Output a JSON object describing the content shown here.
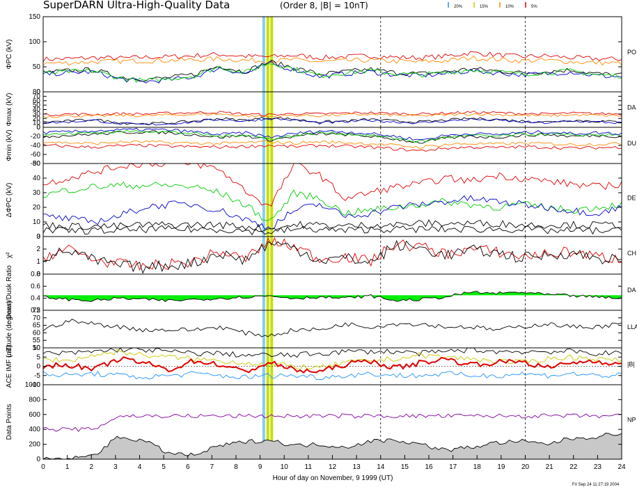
{
  "header": {
    "title": "SuperDARN Ultra-High-Quality Data",
    "subtitle": "(Order 8, |B| = 10nT)",
    "legend": [
      {
        "label": "20%",
        "color": "#1e90ff"
      },
      {
        "label": "15%",
        "color": "#c8c800"
      },
      {
        "label": "10%",
        "color": "#ff8c00"
      },
      {
        "label": "5%",
        "color": "#e00000"
      }
    ]
  },
  "footer": {
    "xlabel": "Hour of day on November, 9 1999 (UT)",
    "timestamp": "Fri Sep 24 11:27:19 2004"
  },
  "highlights": [
    {
      "hour": 9.15,
      "color": "#87ceeb"
    },
    {
      "hour": 9.32,
      "color": "#c8e000"
    },
    {
      "hour": 9.48,
      "color": "#c8e000"
    }
  ],
  "dashed_hours": [
    14,
    20
  ],
  "colors": {
    "red": "#e00000",
    "orange": "#ff8c00",
    "yellow": "#c8c800",
    "green": "#00cc00",
    "blue": "#0000c8",
    "black": "#000000",
    "cyan": "#1e90ff",
    "purple": "#8000a0",
    "gray": "#c8c8c8"
  },
  "chart_data": [
    {
      "id": "phi-pc",
      "type": "line",
      "ylabel": "ΦPC (kV)",
      "side_label": "PO",
      "ylim": [
        0,
        150
      ],
      "yticks": [
        0,
        50,
        100,
        150
      ],
      "xlim": [
        0,
        24
      ],
      "series": [
        {
          "color": "#e00000",
          "base": 68,
          "amp": 6,
          "values": [
            65,
            66,
            68,
            67,
            69,
            70,
            72,
            75,
            71,
            70,
            73,
            68,
            70,
            72,
            69,
            68,
            71,
            78,
            74,
            70,
            72,
            68,
            66,
            65
          ]
        },
        {
          "color": "#ff8c00",
          "base": 60,
          "amp": 5,
          "values": [
            57,
            58,
            60,
            61,
            62,
            63,
            64,
            66,
            63,
            62,
            64,
            60,
            62,
            63,
            61,
            60,
            62,
            68,
            65,
            62,
            63,
            60,
            58,
            57
          ]
        },
        {
          "color": "#000000",
          "base": 40,
          "amp": 9,
          "values": [
            38,
            42,
            44,
            30,
            25,
            28,
            35,
            52,
            40,
            60,
            48,
            35,
            40,
            45,
            38,
            36,
            40,
            46,
            42,
            38,
            40,
            44,
            36,
            34
          ]
        },
        {
          "color": "#0000c8",
          "base": 36,
          "amp": 8,
          "values": [
            35,
            38,
            40,
            26,
            20,
            24,
            30,
            48,
            36,
            56,
            44,
            30,
            36,
            40,
            34,
            32,
            36,
            42,
            38,
            34,
            36,
            40,
            32,
            30
          ]
        },
        {
          "color": "#00cc00",
          "base": 38,
          "amp": 8,
          "values": [
            36,
            40,
            42,
            28,
            22,
            26,
            32,
            50,
            38,
            58,
            46,
            32,
            38,
            42,
            36,
            34,
            38,
            44,
            40,
            36,
            38,
            42,
            34,
            32
          ]
        }
      ]
    },
    {
      "id": "phi-max",
      "type": "line",
      "ylabel": "Φmax (kV)",
      "side_label": "DA",
      "ylim": [
        0,
        80
      ],
      "yticks": [
        0,
        10,
        20,
        30,
        40,
        50,
        60,
        70,
        80
      ],
      "xlim": [
        0,
        24
      ],
      "series": [
        {
          "color": "#e00000",
          "values": [
            28,
            30,
            29,
            31,
            30,
            32,
            33,
            34,
            30,
            28,
            31,
            30,
            32,
            33,
            31,
            30,
            32,
            34,
            33,
            31,
            30,
            32,
            31,
            30
          ]
        },
        {
          "color": "#ff8c00",
          "values": [
            24,
            26,
            25,
            27,
            26,
            28,
            29,
            30,
            26,
            24,
            27,
            26,
            28,
            29,
            27,
            26,
            28,
            30,
            29,
            27,
            26,
            28,
            27,
            26
          ]
        },
        {
          "color": "#000000",
          "values": [
            12,
            14,
            18,
            10,
            8,
            10,
            14,
            20,
            16,
            22,
            18,
            12,
            14,
            18,
            14,
            12,
            16,
            20,
            18,
            14,
            12,
            16,
            14,
            12
          ]
        },
        {
          "color": "#0000c8",
          "values": [
            10,
            12,
            16,
            8,
            6,
            8,
            12,
            18,
            14,
            20,
            16,
            10,
            12,
            16,
            12,
            10,
            14,
            18,
            16,
            12,
            10,
            14,
            12,
            10
          ]
        }
      ]
    },
    {
      "id": "phi-min",
      "type": "line",
      "ylabel": "Φmin (kV)",
      "side_label": "DU",
      "ylim": [
        -80,
        0
      ],
      "yticks": [
        -80,
        -60,
        -40,
        -20,
        0
      ],
      "xlim": [
        0,
        24
      ],
      "series": [
        {
          "color": "#e00000",
          "values": [
            -40,
            -42,
            -44,
            -41,
            -40,
            -42,
            -43,
            -44,
            -42,
            -40,
            -43,
            -40,
            -42,
            -44,
            -48,
            -52,
            -46,
            -44,
            -45,
            -43,
            -44,
            -46,
            -45,
            -44
          ]
        },
        {
          "color": "#ff8c00",
          "values": [
            -32,
            -34,
            -36,
            -33,
            -32,
            -34,
            -35,
            -36,
            -34,
            -32,
            -35,
            -32,
            -34,
            -36,
            -40,
            -44,
            -38,
            -36,
            -37,
            -35,
            -36,
            -38,
            -37,
            -36
          ]
        },
        {
          "color": "#000000",
          "values": [
            -20,
            -18,
            -15,
            -12,
            -10,
            -12,
            -16,
            -22,
            -18,
            -28,
            -20,
            -14,
            -16,
            -20,
            -26,
            -34,
            -24,
            -20,
            -22,
            -18,
            -16,
            -20,
            -18,
            -20
          ]
        },
        {
          "color": "#00cc00",
          "values": [
            -16,
            -14,
            -12,
            -10,
            -8,
            -10,
            -14,
            -20,
            -16,
            -26,
            -18,
            -12,
            -14,
            -18,
            -24,
            -32,
            -22,
            -18,
            -20,
            -16,
            -14,
            -18,
            -16,
            -18
          ]
        },
        {
          "color": "#0000c8",
          "values": [
            -12,
            -10,
            -8,
            -6,
            -5,
            -6,
            -10,
            -16,
            -12,
            -22,
            -14,
            -8,
            -10,
            -14,
            -20,
            -28,
            -18,
            -14,
            -16,
            -12,
            -10,
            -14,
            -12,
            -14
          ]
        }
      ]
    },
    {
      "id": "delta-phi-pc",
      "type": "line",
      "ylabel": "ΔΦPC (kV)",
      "side_label": "DE",
      "ylim": [
        0,
        50
      ],
      "yticks": [
        0,
        10,
        20,
        30,
        40,
        50
      ],
      "xlim": [
        0,
        24
      ],
      "series": [
        {
          "color": "#e00000",
          "values": [
            36,
            40,
            44,
            48,
            50,
            50,
            50,
            46,
            32,
            20,
            50,
            42,
            26,
            30,
            34,
            36,
            40,
            38,
            42,
            40,
            38,
            36,
            34,
            36
          ]
        },
        {
          "color": "#00cc00",
          "values": [
            28,
            32,
            34,
            35,
            35,
            35,
            34,
            30,
            22,
            10,
            30,
            26,
            16,
            18,
            20,
            22,
            24,
            22,
            20,
            22,
            20,
            18,
            20,
            22
          ]
        },
        {
          "color": "#0000c8",
          "values": [
            14,
            12,
            10,
            14,
            20,
            22,
            22,
            18,
            12,
            6,
            18,
            22,
            14,
            16,
            20,
            22,
            24,
            26,
            24,
            22,
            20,
            18,
            16,
            20
          ]
        },
        {
          "color": "#000000",
          "values": [
            8,
            7,
            7,
            7,
            8,
            8,
            8,
            8,
            7,
            5,
            8,
            8,
            7,
            8,
            8,
            9,
            9,
            9,
            9,
            8,
            8,
            8,
            8,
            8
          ]
        },
        {
          "color": "#000000",
          "values": [
            4,
            4,
            4,
            4,
            5,
            5,
            5,
            5,
            4,
            3,
            5,
            5,
            4,
            5,
            5,
            5,
            5,
            5,
            5,
            5,
            4,
            4,
            4,
            4
          ]
        }
      ]
    },
    {
      "id": "chi-sq",
      "type": "line",
      "ylabel": "χ²",
      "side_label": "CH",
      "ylim": [
        0,
        3
      ],
      "yticks": [
        0,
        1,
        2,
        3
      ],
      "xlim": [
        0,
        24
      ],
      "series": [
        {
          "color": "#e00000",
          "values": [
            1.4,
            2.0,
            1.2,
            0.8,
            0.6,
            0.8,
            1.0,
            1.8,
            1.2,
            2.6,
            2.2,
            1.2,
            1.4,
            1.0,
            2.4,
            2.2,
            1.6,
            2.0,
            1.8,
            1.4,
            1.6,
            1.8,
            1.4,
            1.2
          ]
        },
        {
          "color": "#000000",
          "values": [
            1.3,
            1.9,
            1.1,
            0.7,
            0.5,
            0.7,
            0.9,
            1.7,
            1.1,
            2.5,
            2.1,
            1.1,
            1.3,
            0.9,
            2.3,
            2.1,
            1.5,
            1.9,
            1.7,
            1.3,
            1.5,
            1.7,
            1.3,
            1.1
          ]
        }
      ]
    },
    {
      "id": "dawn-dusk",
      "type": "area",
      "ylabel": "Dawn/Dusk Ratio",
      "side_label": "DA",
      "ylim": [
        0.2,
        0.8
      ],
      "yticks": [
        0.2,
        0.4,
        0.6,
        0.8
      ],
      "xlim": [
        0,
        24
      ],
      "series": [
        {
          "color": "#000000",
          "values": [
            0.42,
            0.38,
            0.36,
            0.4,
            0.38,
            0.36,
            0.38,
            0.4,
            0.42,
            0.44,
            0.4,
            0.42,
            0.4,
            0.44,
            0.36,
            0.38,
            0.42,
            0.5,
            0.48,
            0.5,
            0.46,
            0.44,
            0.42,
            0.4
          ]
        }
      ]
    },
    {
      "id": "latitude",
      "type": "line",
      "ylabel": "Latitude (degrees)",
      "side_label": "LLA",
      "ylim": [
        50,
        75
      ],
      "yticks": [
        50,
        55,
        60,
        65,
        70,
        75
      ],
      "xlim": [
        0,
        24
      ],
      "series": [
        {
          "color": "#000000",
          "values": [
            62,
            68,
            66,
            64,
            62,
            62,
            62,
            64,
            60,
            58,
            62,
            62,
            66,
            64,
            66,
            66,
            64,
            64,
            62,
            64,
            66,
            64,
            64,
            66
          ]
        }
      ]
    },
    {
      "id": "imf",
      "type": "line",
      "ylabel": "ACE IMF (nT)",
      "side_label": "|B|",
      "ylim": [
        -10,
        10
      ],
      "yticks": [
        -10,
        -5,
        0,
        5,
        10
      ],
      "xlim": [
        0,
        24
      ],
      "series": [
        {
          "color": "#000000",
          "values": [
            7,
            7,
            8,
            9,
            9,
            8,
            7,
            7,
            6,
            6,
            6,
            7,
            8,
            8,
            8,
            7,
            8,
            9,
            8,
            8,
            8,
            8,
            7,
            7
          ]
        },
        {
          "color": "#c8c800",
          "values": [
            4,
            3,
            6,
            8,
            6,
            5,
            4,
            3,
            2,
            1,
            0,
            -1,
            2,
            3,
            4,
            6,
            5,
            4,
            3,
            2,
            4,
            5,
            4,
            3
          ]
        },
        {
          "color": "#e00000",
          "values": [
            0,
            1,
            -2,
            4,
            2,
            -2,
            3,
            1,
            -3,
            2,
            -2,
            -3,
            1,
            3,
            -1,
            2,
            4,
            1,
            2,
            3,
            -1,
            2,
            3,
            1
          ]
        },
        {
          "color": "#1e90ff",
          "values": [
            -4,
            -5,
            -4,
            -5,
            -6,
            -5,
            -4,
            -5,
            -6,
            -5,
            -5,
            -6,
            -5,
            -4,
            -5,
            -5,
            -4,
            -5,
            -5,
            -4,
            -5,
            -4,
            -5,
            -5
          ]
        }
      ]
    },
    {
      "id": "data-points",
      "type": "area",
      "ylabel": "Data Points",
      "side_label": "NP",
      "ylim": [
        0,
        1000
      ],
      "yticks": [
        0,
        200,
        400,
        600,
        800,
        1000
      ],
      "xlim": [
        0,
        24
      ],
      "series": [
        {
          "color": "#000000",
          "values": [
            0,
            0,
            50,
            300,
            250,
            80,
            50,
            180,
            230,
            260,
            180,
            200,
            160,
            240,
            260,
            200,
            120,
            160,
            220,
            240,
            200,
            280,
            300,
            360
          ]
        },
        {
          "color": "#8000a0",
          "values": [
            400,
            400,
            400,
            580,
            580,
            580,
            580,
            580,
            580,
            580,
            580,
            580,
            580,
            580,
            580,
            580,
            580,
            580,
            580,
            580,
            580,
            580,
            580,
            580
          ]
        }
      ]
    }
  ]
}
